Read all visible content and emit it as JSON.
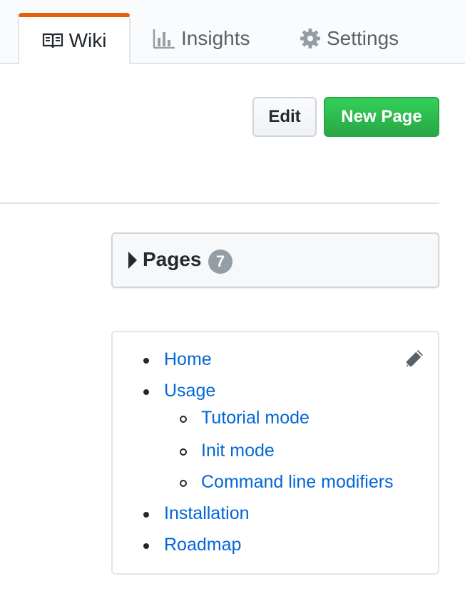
{
  "tabs": {
    "wiki": {
      "label": "Wiki",
      "icon": "book-icon",
      "selected": true
    },
    "insights": {
      "label": "Insights",
      "icon": "graph-icon"
    },
    "settings": {
      "label": "Settings",
      "icon": "gear-icon"
    }
  },
  "actions": {
    "edit_label": "Edit",
    "new_page_label": "New Page"
  },
  "pages_panel": {
    "label": "Pages",
    "count": "7",
    "expanded": false
  },
  "sidebar": {
    "edit_icon": "pencil-icon",
    "items": [
      {
        "label": "Home"
      },
      {
        "label": "Usage"
      },
      {
        "label": "Tutorial mode"
      },
      {
        "label": "Init mode"
      },
      {
        "label": "Command line modifiers"
      },
      {
        "label": "Installation"
      },
      {
        "label": "Roadmap"
      }
    ]
  },
  "colors": {
    "accent_tab": "#e36209",
    "link": "#0366d6",
    "primary_button": "#28a745",
    "counter_bg": "#959da5"
  }
}
